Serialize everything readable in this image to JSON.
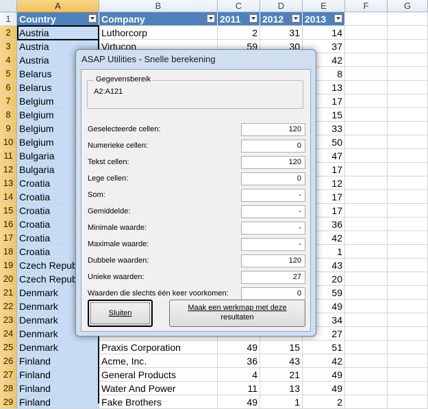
{
  "sheet": {
    "columns": [
      "A",
      "B",
      "C",
      "D",
      "E",
      "F",
      "G"
    ],
    "headers": [
      "Country",
      "Company",
      "2011",
      "2012",
      "2013"
    ],
    "rows": [
      {
        "num": "1"
      },
      {
        "num": "2",
        "country": "Austria",
        "company": "Luthorcorp",
        "y2011": "2",
        "y2012": "31",
        "y2013": "14"
      },
      {
        "num": "3",
        "country": "Austria",
        "company": "Virtucon",
        "y2011": "59",
        "y2012": "30",
        "y2013": "37"
      },
      {
        "num": "4",
        "country": "Austria",
        "company": "",
        "y2011": "",
        "y2012": "",
        "y2013": "42"
      },
      {
        "num": "5",
        "country": "Belarus",
        "company": "",
        "y2011": "",
        "y2012": "",
        "y2013": "8"
      },
      {
        "num": "6",
        "country": "Belarus",
        "company": "",
        "y2011": "",
        "y2012": "",
        "y2013": "13"
      },
      {
        "num": "7",
        "country": "Belgium",
        "company": "",
        "y2011": "",
        "y2012": "",
        "y2013": "17"
      },
      {
        "num": "8",
        "country": "Belgium",
        "company": "",
        "y2011": "",
        "y2012": "",
        "y2013": "15"
      },
      {
        "num": "9",
        "country": "Belgium",
        "company": "",
        "y2011": "",
        "y2012": "",
        "y2013": "33"
      },
      {
        "num": "10",
        "country": "Belgium",
        "company": "",
        "y2011": "",
        "y2012": "",
        "y2013": "50"
      },
      {
        "num": "11",
        "country": "Bulgaria",
        "company": "",
        "y2011": "",
        "y2012": "",
        "y2013": "47"
      },
      {
        "num": "12",
        "country": "Bulgaria",
        "company": "",
        "y2011": "",
        "y2012": "",
        "y2013": "17"
      },
      {
        "num": "13",
        "country": "Croatia",
        "company": "",
        "y2011": "",
        "y2012": "",
        "y2013": "12"
      },
      {
        "num": "14",
        "country": "Croatia",
        "company": "",
        "y2011": "",
        "y2012": "",
        "y2013": "17"
      },
      {
        "num": "15",
        "country": "Croatia",
        "company": "",
        "y2011": "",
        "y2012": "",
        "y2013": "17"
      },
      {
        "num": "16",
        "country": "Croatia",
        "company": "",
        "y2011": "",
        "y2012": "",
        "y2013": "36"
      },
      {
        "num": "17",
        "country": "Croatia",
        "company": "",
        "y2011": "",
        "y2012": "",
        "y2013": "42"
      },
      {
        "num": "18",
        "country": "Croatia",
        "company": "",
        "y2011": "",
        "y2012": "",
        "y2013": "1"
      },
      {
        "num": "19",
        "country": "Czech Republ",
        "company": "",
        "y2011": "",
        "y2012": "",
        "y2013": "43"
      },
      {
        "num": "20",
        "country": "Czech Republ",
        "company": "",
        "y2011": "",
        "y2012": "",
        "y2013": "20"
      },
      {
        "num": "21",
        "country": "Denmark",
        "company": "",
        "y2011": "",
        "y2012": "",
        "y2013": "59"
      },
      {
        "num": "22",
        "country": "Denmark",
        "company": "",
        "y2011": "",
        "y2012": "",
        "y2013": "49"
      },
      {
        "num": "23",
        "country": "Denmark",
        "company": "",
        "y2011": "",
        "y2012": "",
        "y2013": "34"
      },
      {
        "num": "24",
        "country": "Denmark",
        "company": "",
        "y2011": "",
        "y2012": "",
        "y2013": "27"
      },
      {
        "num": "25",
        "country": "Denmark",
        "company": "Praxis Corporation",
        "y2011": "49",
        "y2012": "15",
        "y2013": "51"
      },
      {
        "num": "26",
        "country": "Finland",
        "company": "Acme, Inc.",
        "y2011": "36",
        "y2012": "43",
        "y2013": "42"
      },
      {
        "num": "27",
        "country": "Finland",
        "company": "General Products",
        "y2011": "4",
        "y2012": "21",
        "y2013": "49"
      },
      {
        "num": "28",
        "country": "Finland",
        "company": "Water And Power",
        "y2011": "11",
        "y2012": "13",
        "y2013": "49"
      },
      {
        "num": "29",
        "country": "Finland",
        "company": "Fake Brothers",
        "y2011": "49",
        "y2012": "1",
        "y2013": "2"
      }
    ]
  },
  "dialog": {
    "title": "ASAP Utilities - Snelle berekening",
    "group_title": "Gegevensbereik",
    "range": "A2:A121",
    "stats": [
      {
        "label": "Geselecteerde cellen:",
        "value": "120"
      },
      {
        "label": "Numerieke cellen:",
        "value": "0"
      },
      {
        "label": "Tekst cellen:",
        "value": "120"
      },
      {
        "label": "Lege cellen:",
        "value": "0"
      },
      {
        "label": "Som:",
        "value": "-"
      },
      {
        "label": "Gemiddelde:",
        "value": "-"
      },
      {
        "label": "Minimale waarde:",
        "value": "-"
      },
      {
        "label": "Maximale waarde:",
        "value": "-"
      },
      {
        "label": "Dubbele waarden:",
        "value": "120"
      },
      {
        "label": "Unieke waarden:",
        "value": "27"
      },
      {
        "label": "Waarden die slechts één keer voorkomen:",
        "value": "0"
      }
    ],
    "close_label": "Sluiten",
    "workbook_label_line1": "Maak een werkmap met deze",
    "workbook_label_line2": "resultaten"
  }
}
